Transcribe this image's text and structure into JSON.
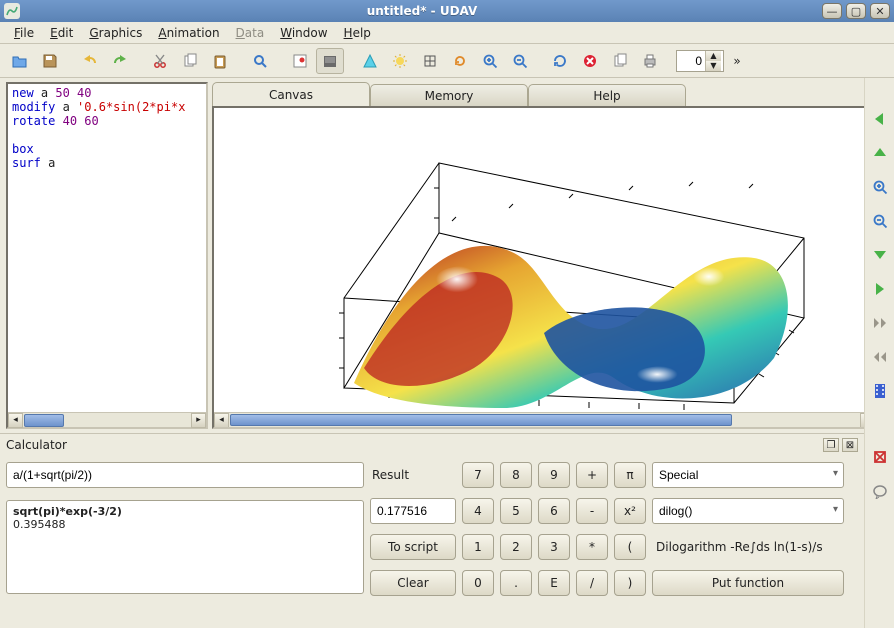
{
  "window": {
    "title": "untitled* - UDAV"
  },
  "menu": {
    "file": "File",
    "edit": "Edit",
    "graphics": "Graphics",
    "animation": "Animation",
    "data": "Data",
    "window": "Window",
    "help": "Help"
  },
  "toolbar": {
    "spin_value": "0"
  },
  "tabs": {
    "canvas": "Canvas",
    "memory": "Memory",
    "help": "Help"
  },
  "code": {
    "l1a": "new",
    "l1b": " a ",
    "l1c": "50 40",
    "l2a": "modify",
    "l2b": " a ",
    "l2c": "'0.6*sin(2*pi*x",
    "l3a": "rotate",
    "l3b": " ",
    "l3c": "40 60",
    "l4": "",
    "l5a": "box",
    "l6a": "surf",
    "l6b": " a"
  },
  "calc": {
    "title": "Calculator",
    "expr": "a/(1+sqrt(pi/2))",
    "result_label": "Result",
    "result_value": "0.177516",
    "to_script": "To script",
    "clear": "Clear",
    "history_expr": "sqrt(pi)*exp(-3/2)",
    "history_val": "0.395488",
    "keys": {
      "k7": "7",
      "k8": "8",
      "k9": "9",
      "kplus": "+",
      "kpi": "π",
      "k4": "4",
      "k5": "5",
      "k6": "6",
      "kminus": "-",
      "kx2": "x²",
      "k1": "1",
      "k2": "2",
      "k3": "3",
      "kmul": "*",
      "klp": "(",
      "k0": "0",
      "kdot": ".",
      "ke": "E",
      "kdiv": "/",
      "krp": ")"
    },
    "special_label": "Special",
    "func_label": "dilog()",
    "func_desc": "Dilogarithm -Re∫ds ln(1-s)/s",
    "put_func": "Put function"
  },
  "chart_data": {
    "type": "surface3d",
    "title": "",
    "function": "0.6*sin(2*pi*x)",
    "grid": {
      "nx": 50,
      "ny": 40
    },
    "view_rotation": [
      40,
      60
    ],
    "xrange": [
      0,
      1
    ],
    "yrange": [
      0,
      1
    ],
    "zrange": [
      -0.6,
      0.6
    ],
    "box": true,
    "style": "surf",
    "colormap": "default-rainbow",
    "notes": "3D shaded surface plot of z = 0.6*sin(2πx) over a 50×40 grid, rotated (40,60), drawn inside a wireframe box with tick marks on all edges."
  }
}
